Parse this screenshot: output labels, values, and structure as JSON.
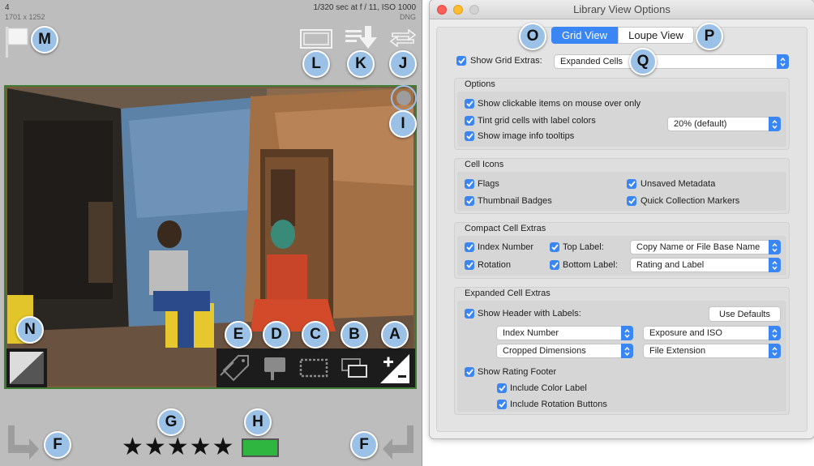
{
  "thumbnail": {
    "index": "4",
    "dimensions": "1701 x 1252",
    "exposure": "1/320 sec at f / 11, ISO 1000",
    "file_type": "DNG",
    "rating_stars": "★★★★★",
    "label_color": "#2fb640",
    "border_color": "#3f7d37"
  },
  "callouts": {
    "A": "A",
    "B": "B",
    "C": "C",
    "D": "D",
    "E": "E",
    "F": "F",
    "G": "G",
    "H": "H",
    "I": "I",
    "J": "J",
    "K": "K",
    "L": "L",
    "M": "M",
    "N": "N",
    "O": "O",
    "P": "P",
    "Q": "Q"
  },
  "icons": {
    "flag": "flag-icon",
    "metadata_badge": "metadata-badge-icon",
    "sort_order": "sort-icon",
    "sync": "sync-icon",
    "target": "target-collection-icon",
    "rotate_left": "rotate-left-icon",
    "rotate_right": "rotate-right-icon",
    "keywords": "keyword-tag-icon",
    "comment": "comment-icon",
    "crop": "crop-icon",
    "virtual_copy": "virtual-copy-icon",
    "develop": "develop-adjust-icon",
    "quick_collection": "quick-collection-icon"
  },
  "dialog": {
    "title": "Library View Options",
    "tabs": [
      "Grid View",
      "Loupe View"
    ],
    "active_tab": "Grid View",
    "show_grid_extras_label": "Show Grid Extras:",
    "show_grid_extras_value": "Expanded Cells",
    "options": {
      "heading": "Options",
      "clickable": "Show clickable items on mouse over only",
      "tint": "Tint grid cells with label colors",
      "tint_value": "20% (default)",
      "tooltips": "Show image info tooltips"
    },
    "cell_icons": {
      "heading": "Cell Icons",
      "flags": "Flags",
      "unsaved": "Unsaved Metadata",
      "badges": "Thumbnail Badges",
      "quick": "Quick Collection Markers"
    },
    "compact": {
      "heading": "Compact Cell Extras",
      "index": "Index Number",
      "top_label": "Top Label:",
      "top_value": "Copy Name or File Base Name",
      "rotation": "Rotation",
      "bottom_label": "Bottom Label:",
      "bottom_value": "Rating and Label"
    },
    "expanded": {
      "heading": "Expanded Cell Extras",
      "header": "Show Header with Labels:",
      "defaults": "Use Defaults",
      "sel1": "Index Number",
      "sel2": "Exposure and ISO",
      "sel3": "Cropped Dimensions",
      "sel4": "File Extension",
      "footer": "Show Rating Footer",
      "color_label": "Include Color Label",
      "rotation_buttons": "Include Rotation Buttons"
    },
    "accent": "#3a86f5"
  }
}
